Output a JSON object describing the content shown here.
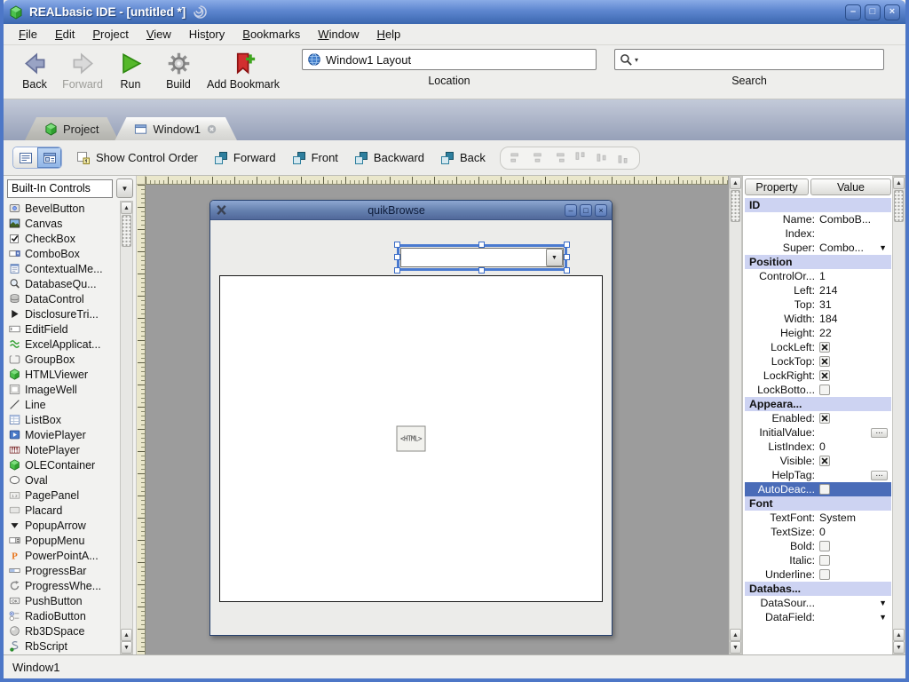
{
  "window": {
    "title": "REALbasic IDE - [untitled *]",
    "controls": [
      {
        "name": "minimize",
        "glyph": "–"
      },
      {
        "name": "maximize",
        "glyph": "□"
      },
      {
        "name": "close",
        "glyph": "×"
      }
    ]
  },
  "menubar": {
    "items": [
      {
        "label": "File",
        "mnemonic": "F"
      },
      {
        "label": "Edit",
        "mnemonic": "E"
      },
      {
        "label": "Project",
        "mnemonic": "P"
      },
      {
        "label": "View",
        "mnemonic": "V"
      },
      {
        "label": "History",
        "mnemonic": "t"
      },
      {
        "label": "Bookmarks",
        "mnemonic": "B"
      },
      {
        "label": "Window",
        "mnemonic": "W"
      },
      {
        "label": "Help",
        "mnemonic": "H"
      }
    ]
  },
  "toolbar": {
    "buttons": [
      {
        "label": "Back",
        "icon": "back-arrow",
        "disabled": false
      },
      {
        "label": "Forward",
        "icon": "forward-arrow",
        "disabled": true
      },
      {
        "label": "Run",
        "icon": "run-play",
        "disabled": false
      },
      {
        "label": "Build",
        "icon": "build-gear",
        "disabled": false
      },
      {
        "label": "Add Bookmark",
        "icon": "add-bookmark",
        "disabled": false,
        "wide": true
      }
    ],
    "location": {
      "label": "Location",
      "value": "Window1 Layout",
      "icon": "globe"
    },
    "search": {
      "label": "Search",
      "value": "",
      "icon": "magnifier"
    }
  },
  "tabs": [
    {
      "label": "Project",
      "icon": "green-cube",
      "active": false,
      "closable": false
    },
    {
      "label": "Window1",
      "icon": "window-doc",
      "active": true,
      "closable": true
    }
  ],
  "layout_toolbar": {
    "view_toggles": [
      {
        "name": "list-view",
        "icon": "view-list",
        "selected": false
      },
      {
        "name": "layout-view",
        "icon": "view-layout",
        "selected": true
      }
    ],
    "buttons": [
      {
        "label": "Show Control Order",
        "icon": "control-order"
      },
      {
        "label": "Forward",
        "icon": "layer-forward"
      },
      {
        "label": "Front",
        "icon": "layer-front"
      },
      {
        "label": "Backward",
        "icon": "layer-backward"
      },
      {
        "label": "Back",
        "icon": "layer-back"
      }
    ],
    "align_buttons": [
      "align-left",
      "align-center-h",
      "align-right",
      "align-top",
      "align-middle-v",
      "align-bottom"
    ]
  },
  "sidebar": {
    "selector": "Built-In Controls",
    "controls": [
      {
        "name": "BevelButton",
        "icon": "bevel-button"
      },
      {
        "name": "Canvas",
        "icon": "canvas-image"
      },
      {
        "name": "CheckBox",
        "icon": "checkbox-glyph"
      },
      {
        "name": "ComboBox",
        "icon": "combobox-glyph"
      },
      {
        "name": "ContextualMe...",
        "icon": "contextual-menu"
      },
      {
        "name": "DatabaseQu...",
        "icon": "database-query"
      },
      {
        "name": "DataControl",
        "icon": "data-control"
      },
      {
        "name": "DisclosureTri...",
        "icon": "disclosure-triangle"
      },
      {
        "name": "EditField",
        "icon": "edit-field"
      },
      {
        "name": "ExcelApplicat...",
        "icon": "excel-app"
      },
      {
        "name": "GroupBox",
        "icon": "group-box"
      },
      {
        "name": "HTMLViewer",
        "icon": "green-cube"
      },
      {
        "name": "ImageWell",
        "icon": "image-well"
      },
      {
        "name": "Line",
        "icon": "line-glyph"
      },
      {
        "name": "ListBox",
        "icon": "list-box"
      },
      {
        "name": "MoviePlayer",
        "icon": "movie-player"
      },
      {
        "name": "NotePlayer",
        "icon": "note-player"
      },
      {
        "name": "OLEContainer",
        "icon": "green-cube"
      },
      {
        "name": "Oval",
        "icon": "oval-glyph"
      },
      {
        "name": "PagePanel",
        "icon": "page-panel"
      },
      {
        "name": "Placard",
        "icon": "placard-glyph"
      },
      {
        "name": "PopupArrow",
        "icon": "popup-arrow"
      },
      {
        "name": "PopupMenu",
        "icon": "popup-menu"
      },
      {
        "name": "PowerPointA...",
        "icon": "powerpoint-app"
      },
      {
        "name": "ProgressBar",
        "icon": "progress-bar"
      },
      {
        "name": "ProgressWhe...",
        "icon": "progress-wheel"
      },
      {
        "name": "PushButton",
        "icon": "push-button"
      },
      {
        "name": "RadioButton",
        "icon": "radio-button"
      },
      {
        "name": "Rb3DSpace",
        "icon": "rb3dspace"
      },
      {
        "name": "RbScript",
        "icon": "rb-script"
      }
    ]
  },
  "canvas": {
    "design_window": {
      "title": "quikBrowse",
      "controls": [
        {
          "name": "minimize",
          "glyph": "–"
        },
        {
          "name": "maximize",
          "glyph": "□"
        },
        {
          "name": "close",
          "glyph": "×"
        }
      ]
    },
    "htmlviewer_badge": "<HTML>"
  },
  "props": {
    "header": {
      "property": "Property",
      "value": "Value"
    },
    "sections": [
      {
        "title": "ID",
        "rows": [
          {
            "label": "Name:",
            "value": "ComboB..."
          },
          {
            "label": "Index:",
            "value": ""
          },
          {
            "label": "Super:",
            "value": "Combo...",
            "control": "dropdown"
          }
        ]
      },
      {
        "title": "Position",
        "rows": [
          {
            "label": "ControlOr...",
            "value": "1"
          },
          {
            "label": "Left:",
            "value": "214"
          },
          {
            "label": "Top:",
            "value": "31"
          },
          {
            "label": "Width:",
            "value": "184"
          },
          {
            "label": "Height:",
            "value": "22"
          },
          {
            "label": "LockLeft:",
            "control": "checkbox",
            "checked": true
          },
          {
            "label": "LockTop:",
            "control": "checkbox",
            "checked": true
          },
          {
            "label": "LockRight:",
            "control": "checkbox",
            "checked": true
          },
          {
            "label": "LockBotto...",
            "control": "checkbox",
            "checked": false
          }
        ]
      },
      {
        "title": "Appeara...",
        "rows": [
          {
            "label": "Enabled:",
            "control": "checkbox",
            "checked": true
          },
          {
            "label": "InitialValue:",
            "control": "ellipsis"
          },
          {
            "label": "ListIndex:",
            "value": "0"
          },
          {
            "label": "Visible:",
            "control": "checkbox",
            "checked": true
          },
          {
            "label": "HelpTag:",
            "control": "ellipsis"
          },
          {
            "label": "AutoDeac...",
            "control": "checkbox",
            "checked": false,
            "selected": true
          }
        ]
      },
      {
        "title": "Font",
        "rows": [
          {
            "label": "TextFont:",
            "value": "System"
          },
          {
            "label": "TextSize:",
            "value": "0"
          },
          {
            "label": "Bold:",
            "control": "checkbox",
            "checked": false
          },
          {
            "label": "Italic:",
            "control": "checkbox",
            "checked": false
          },
          {
            "label": "Underline:",
            "control": "checkbox",
            "checked": false
          }
        ]
      },
      {
        "title": "Databas...",
        "rows": [
          {
            "label": "DataSour...",
            "value": "",
            "control": "dropdown"
          },
          {
            "label": "DataField:",
            "value": "",
            "control": "dropdown"
          }
        ]
      }
    ]
  },
  "statusbar": {
    "text": "Window1"
  }
}
